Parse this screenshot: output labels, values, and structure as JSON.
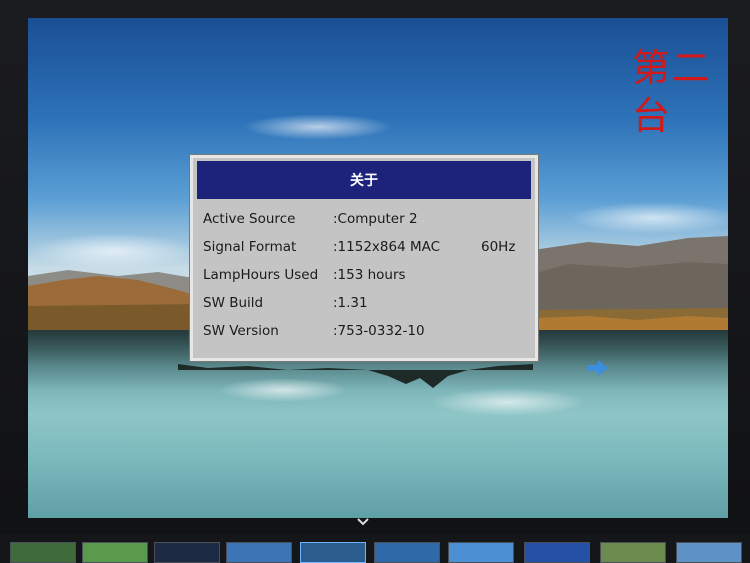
{
  "watermark": "第二台",
  "dialog": {
    "title": "关于",
    "rows": [
      {
        "label": "Active Source",
        "value": ":Computer 2",
        "extra": ""
      },
      {
        "label": "Signal Format",
        "value": ":1152x864 MAC",
        "extra": "60Hz"
      },
      {
        "label": "LampHours Used",
        "value": ":153 hours",
        "extra": ""
      },
      {
        "label": "SW Build",
        "value": ":1.31",
        "extra": ""
      },
      {
        "label": "SW Version",
        "value": ":753-0332-10",
        "extra": ""
      }
    ]
  },
  "icons": {
    "next": "arrow-right-icon",
    "expand": "chevron-down-icon"
  },
  "colors": {
    "title_bar": "#1d237a",
    "dialog_bg": "#c4c4c4",
    "watermark": "#d21818",
    "accent_arrow": "#3a8fe0"
  },
  "thumbnails": [
    {
      "name": "mountain-forest",
      "color": "#3f6a3a"
    },
    {
      "name": "green-hills",
      "color": "#5a9a4c"
    },
    {
      "name": "dark-night",
      "color": "#1c2a44"
    },
    {
      "name": "sky-blue",
      "color": "#3c74b6"
    },
    {
      "name": "selected-lake",
      "color": "#2b5d8f",
      "selected": true
    },
    {
      "name": "ocean",
      "color": "#2f6aa8"
    },
    {
      "name": "blue-sky",
      "color": "#4d8fd3"
    },
    {
      "name": "deep-blue",
      "color": "#2450a6"
    },
    {
      "name": "field",
      "color": "#6b8a4d"
    },
    {
      "name": "cloud-sky",
      "color": "#5e92c6"
    }
  ]
}
